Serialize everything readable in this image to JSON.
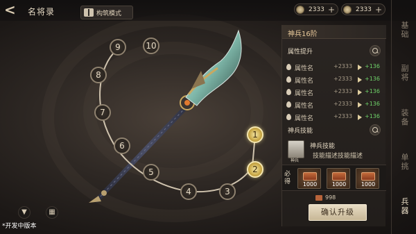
{
  "header": {
    "title": "名将录",
    "mode_label": "构筑模式",
    "currencies": [
      {
        "icon": "coin-icon",
        "value": "2333"
      },
      {
        "icon": "coin-icon",
        "value": "2333"
      }
    ]
  },
  "tiers": {
    "nodes": [
      "1",
      "2",
      "3",
      "4",
      "5",
      "6",
      "7",
      "8",
      "9",
      "10"
    ],
    "active": [
      "1",
      "2"
    ]
  },
  "footer": {
    "dev_note": "*开发中版本"
  },
  "panel": {
    "title": "神兵16阶",
    "attr_section_label": "属性提升",
    "attributes": [
      {
        "name": "属性名",
        "value": "+2333",
        "gain": "+136"
      },
      {
        "name": "属性名",
        "value": "+2333",
        "gain": "+136"
      },
      {
        "name": "属性名",
        "value": "+2333",
        "gain": "+136"
      },
      {
        "name": "属性名",
        "value": "+2333",
        "gain": "+136"
      },
      {
        "name": "属性名",
        "value": "+2333",
        "gain": "+136"
      }
    ],
    "skill_section_label": "神兵技能",
    "skill": {
      "name": "神兵技能",
      "desc": "技能描述技能描述",
      "tag": "神兵"
    },
    "must_label": "必得",
    "materials": [
      {
        "count": "1000"
      },
      {
        "count": "1000"
      },
      {
        "count": "1000"
      }
    ],
    "stock": "998",
    "confirm_label": "确认升级"
  },
  "tabs": [
    {
      "label": "基础",
      "active": false
    },
    {
      "label": "副将",
      "active": false
    },
    {
      "label": "装备",
      "active": false
    },
    {
      "label": "单挑",
      "active": false
    },
    {
      "label": "兵器",
      "active": true
    }
  ],
  "colors": {
    "accent_gold": "#c9a846",
    "gain_green": "#6fd36a",
    "title_orange": "#e8c99a"
  }
}
